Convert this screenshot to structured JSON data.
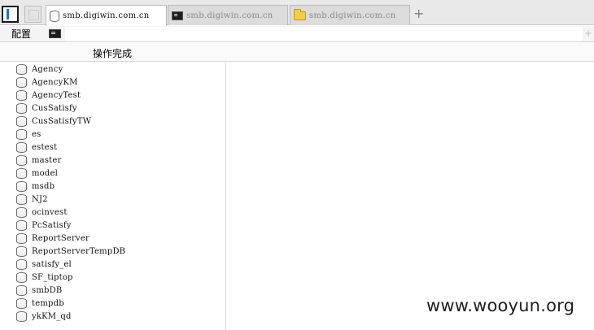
{
  "tabs": [
    {
      "label": "smb.digiwin.com.cn",
      "icon": "database-icon",
      "active": true
    },
    {
      "label": "smb.digiwin.com.cn",
      "icon": "terminal-icon",
      "active": false
    },
    {
      "label": "smb.digiwin.com.cn",
      "icon": "folder-icon",
      "active": false
    }
  ],
  "add_tab_label": "+",
  "toolbar": {
    "config_label": "配置",
    "command_value": "",
    "expand_symbol": "+"
  },
  "status": {
    "text": "操作完成"
  },
  "databases": [
    "Agency",
    "AgencyKM",
    "AgencyTest",
    "CusSatisfy",
    "CusSatisfyTW",
    "es",
    "estest",
    "master",
    "model",
    "msdb",
    "NJ2",
    "ocinvest",
    "PcSatisfy",
    "ReportServer",
    "ReportServerTempDB",
    "satisfy_el",
    "SF_tiptop",
    "smbDB",
    "tempdb",
    "ykKM_qd"
  ],
  "watermark": "www.wooyun.org",
  "colors": {
    "folder": "#f5cc4b",
    "layout_accent": "#1778c8"
  }
}
